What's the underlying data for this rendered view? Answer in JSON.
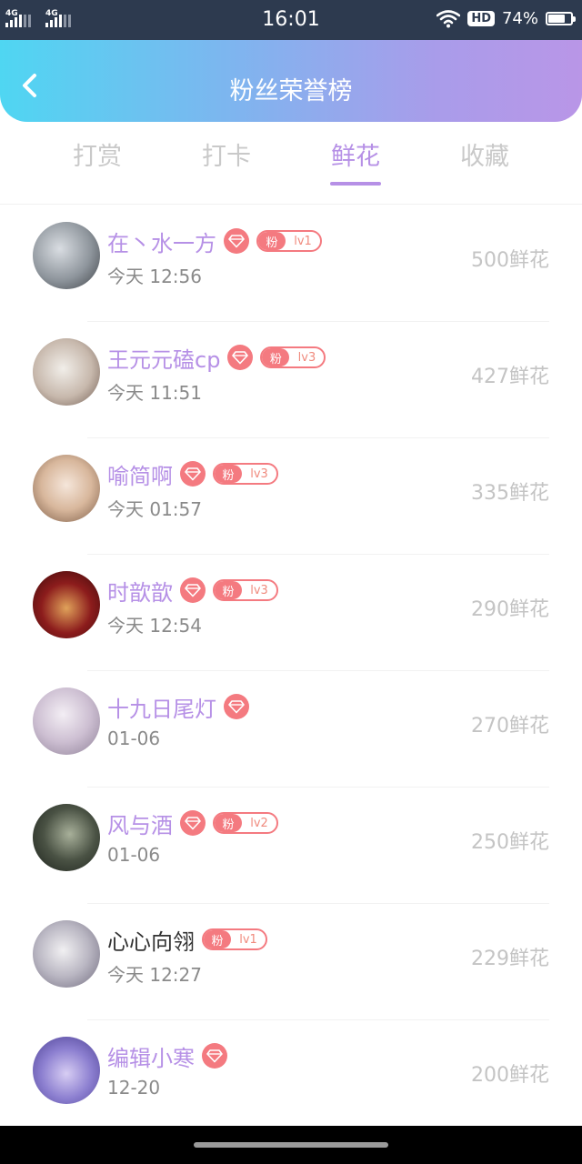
{
  "status_bar": {
    "signal_1": "4G",
    "signal_2": "4G",
    "time": "16:01",
    "wifi_icon": "wifi-icon",
    "hd": "HD",
    "battery": "74%",
    "battery_level": 0.74
  },
  "header": {
    "back_icon": "chevron-left-icon",
    "title": "粉丝荣誉榜",
    "colors": {
      "gradient_start": "#4fd6f2",
      "gradient_end": "#b996e7"
    }
  },
  "tabs": [
    {
      "label": "打赏",
      "active": false
    },
    {
      "label": "打卡",
      "active": false
    },
    {
      "label": "鲜花",
      "active": true
    },
    {
      "label": "收藏",
      "active": false
    }
  ],
  "colors": {
    "accent": "#b690e6",
    "badge": "#f47a80",
    "muted": "#c4c4c4"
  },
  "list": [
    {
      "name": "在丶水一方",
      "highlight": true,
      "gem": true,
      "fan_badge": "粉",
      "level": "lv1",
      "time": "今天 12:56",
      "amount": "500鲜花"
    },
    {
      "name": "王元元磕cp",
      "highlight": true,
      "gem": true,
      "fan_badge": "粉",
      "level": "lv3",
      "time": "今天 11:51",
      "amount": "427鲜花"
    },
    {
      "name": "喻简啊",
      "highlight": true,
      "gem": true,
      "fan_badge": "粉",
      "level": "lv3",
      "time": "今天 01:57",
      "amount": "335鲜花"
    },
    {
      "name": "时歆歆",
      "highlight": true,
      "gem": true,
      "fan_badge": "粉",
      "level": "lv3",
      "time": "今天 12:54",
      "amount": "290鲜花"
    },
    {
      "name": "十九日尾灯",
      "highlight": true,
      "gem": true,
      "fan_badge": null,
      "level": null,
      "time": "01-06",
      "amount": "270鲜花"
    },
    {
      "name": "风与酒",
      "highlight": true,
      "gem": true,
      "fan_badge": "粉",
      "level": "lv2",
      "time": "01-06",
      "amount": "250鲜花"
    },
    {
      "name": "心心向翎",
      "highlight": false,
      "gem": false,
      "fan_badge": "粉",
      "level": "lv1",
      "time": "今天 12:27",
      "amount": "229鲜花"
    },
    {
      "name": "编辑小寒",
      "highlight": true,
      "gem": true,
      "fan_badge": null,
      "level": null,
      "time": "12-20",
      "amount": "200鲜花"
    }
  ]
}
